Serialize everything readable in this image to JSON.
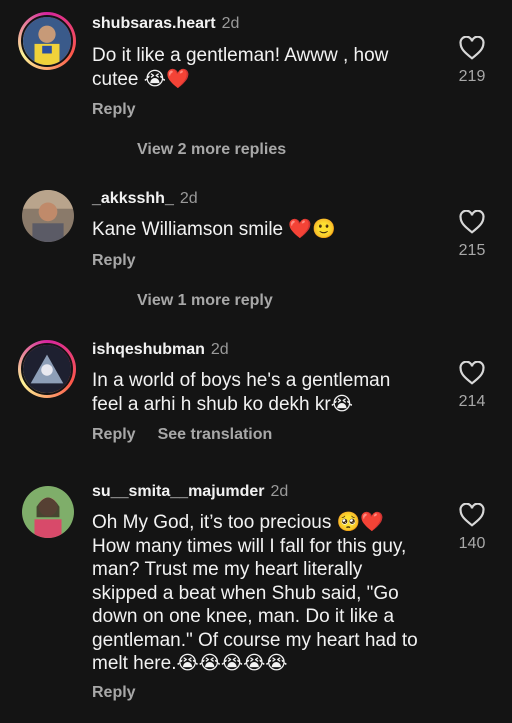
{
  "comments": [
    {
      "username": "shubsaras.heart",
      "age": "2d",
      "text": "Do it like a gentleman! Awww , how cutee 😭❤️",
      "likes": "219",
      "reply_label": "Reply",
      "more_replies": "View 2 more replies"
    },
    {
      "username": "_akksshh_",
      "age": "2d",
      "text": "Kane Williamson smile ❤️🙂",
      "likes": "215",
      "reply_label": "Reply",
      "more_replies": "View 1 more reply"
    },
    {
      "username": "ishqeshubman",
      "age": "2d",
      "text": "In a world of boys he's a gentleman feel a arhi h shub ko dekh kr😭",
      "likes": "214",
      "reply_label": "Reply",
      "translation_label": "See translation"
    },
    {
      "username": "su__smita__majumder",
      "age": "2d",
      "text": "Oh My God, it’s too precious 🥺❤️ How many times will I fall for this guy, man? Trust me my heart literally skipped a beat when Shub said, \"Go down on one knee, man. Do it like a gentleman.\" Of course my heart had to melt here.😭😭😭😭😭",
      "likes": "140",
      "reply_label": "Reply"
    }
  ],
  "colors": {
    "background": "#141414",
    "text_primary": "#f2f2f2",
    "text_secondary": "#a8a8a8"
  },
  "icons": {
    "like": "heart-outline-icon"
  }
}
